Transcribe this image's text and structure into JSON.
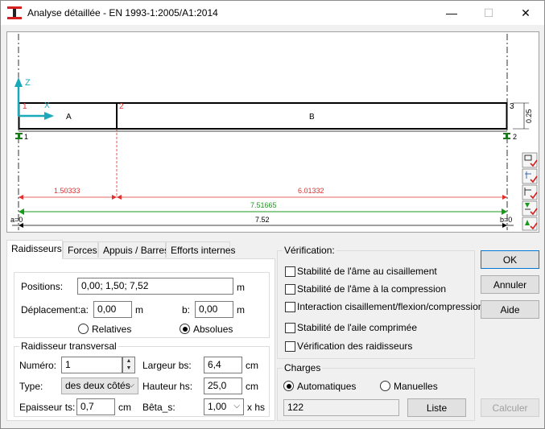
{
  "window": {
    "title": "Analyse détaillée - EN 1993-1:2005/A1:2014",
    "minimize_glyph": "—",
    "maximize_glyph": "☐",
    "close_glyph": "✕"
  },
  "drawing": {
    "axis_z": "Z",
    "axis_x": "X",
    "segment_a": "A",
    "segment_b": "B",
    "node_1": "1",
    "node_2": "2",
    "node_3": "3",
    "support_left": "1",
    "support_right": "2",
    "height_dim": "0.25",
    "dim_a": "1.50333",
    "dim_b": "6.01332",
    "dim_total_green": "7.51665",
    "dim_total": "7.52",
    "a_label": "a=0",
    "b_label": "b=0",
    "colors": {
      "red": "#e03030",
      "green": "#1a9a1a",
      "cyan": "#19a9b8",
      "black": "#000000"
    }
  },
  "tabs": [
    {
      "label": "Raidisseurs",
      "active": true
    },
    {
      "label": "Forces",
      "active": false
    },
    {
      "label": "Appuis / Barres",
      "active": false
    },
    {
      "label": "Efforts internes",
      "active": false
    }
  ],
  "stiffeners": {
    "positions_label": "Positions:",
    "positions_value": "0,00; 1,50; 7,52",
    "positions_unit": "m",
    "displacement_label": "Déplacement:",
    "a_label": "a:",
    "a_value": "0,00",
    "a_unit": "m",
    "b_label": "b:",
    "b_value": "0,00",
    "b_unit": "m",
    "relatives_label": "Relatives",
    "absolues_label": "Absolues",
    "selected_mode": "Absolues"
  },
  "transversal": {
    "group_title": "Raidisseur transversal",
    "numero_label": "Numéro:",
    "numero_value": "1",
    "type_label": "Type:",
    "type_value": "des deux côtés",
    "epaisseur_label": "Epaisseur ts:",
    "epaisseur_value": "0,7",
    "epaisseur_unit": "cm",
    "largeur_label": "Largeur bs:",
    "largeur_value": "6,4",
    "largeur_unit": "cm",
    "hauteur_label": "Hauteur hs:",
    "hauteur_value": "25,0",
    "hauteur_unit": "cm",
    "beta_label": "Bêta_s:",
    "beta_value": "1,00",
    "beta_unit": "x hs"
  },
  "verification": {
    "group_title": "Vérification:",
    "items": [
      "Stabilité de l'âme au cisaillement",
      "Stabilité de l'âme à la compression",
      "Interaction cisaillement/flexion/compression",
      "Stabilité de l'aile comprimée",
      "Vérification des raidisseurs"
    ]
  },
  "charges": {
    "group_title": "Charges",
    "auto_label": "Automatiques",
    "manual_label": "Manuelles",
    "selected": "Automatiques",
    "value": "122",
    "liste_button": "Liste"
  },
  "buttons": {
    "ok": "OK",
    "cancel": "Annuler",
    "help": "Aide",
    "compute": "Calculer"
  }
}
